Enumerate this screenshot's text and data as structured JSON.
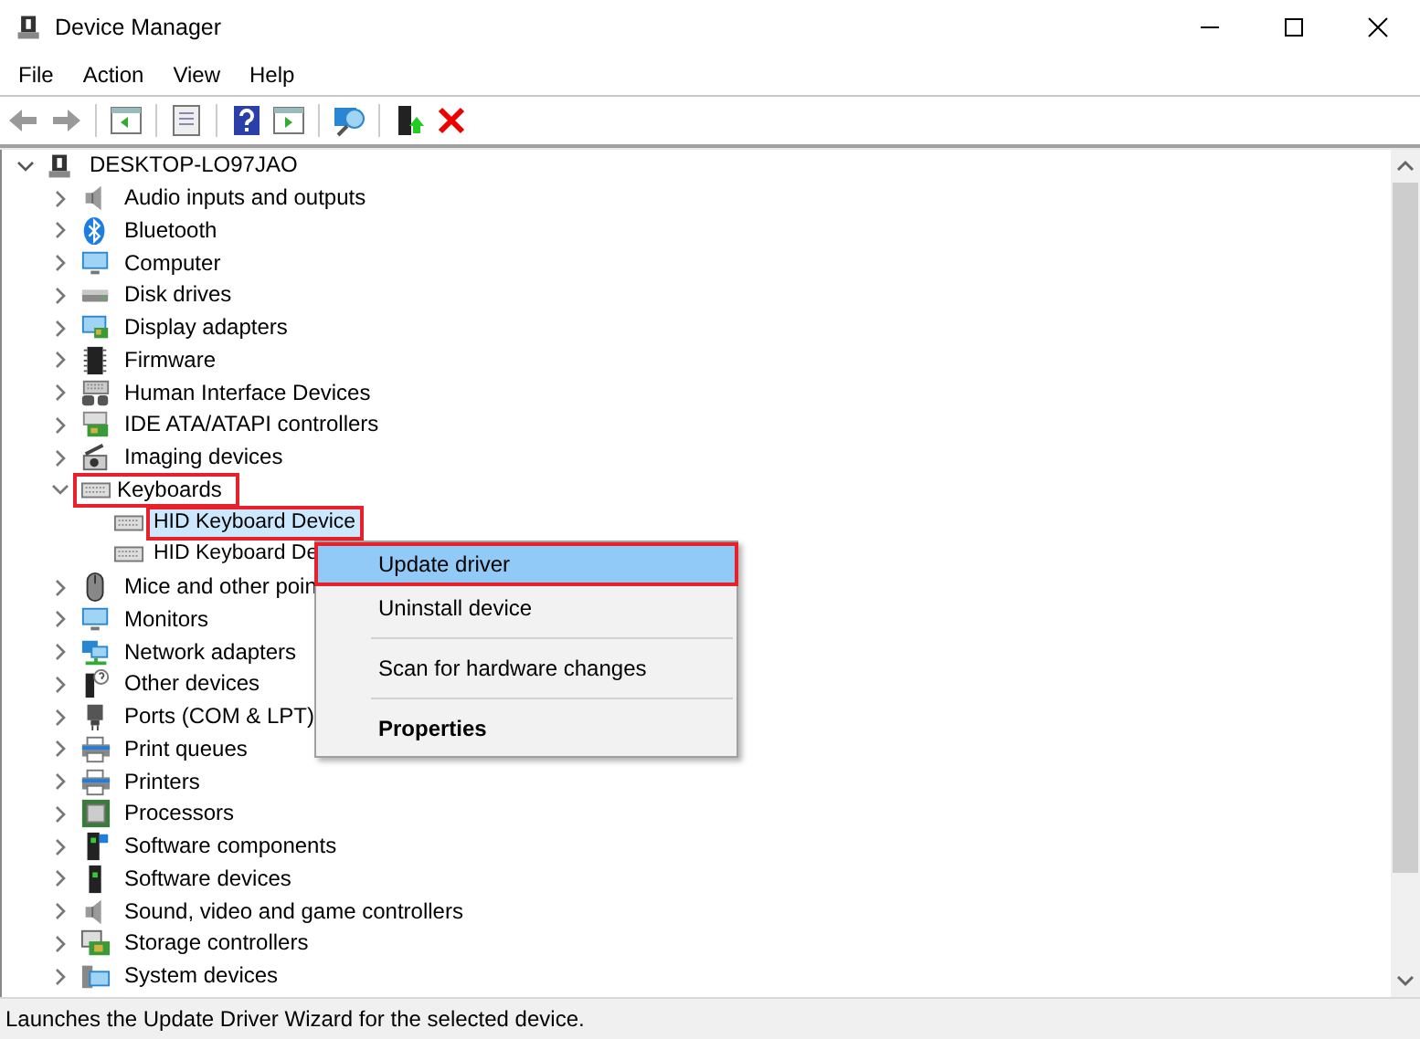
{
  "window": {
    "title": "Device Manager"
  },
  "menu": [
    "File",
    "Action",
    "View",
    "Help"
  ],
  "tree": {
    "label": "DESKTOP-LO97JAO",
    "expanded": true,
    "children": [
      {
        "label": "Audio inputs and outputs",
        "expanded": false,
        "selected": false,
        "highlighted": false
      },
      {
        "label": "Bluetooth",
        "expanded": false,
        "selected": false,
        "highlighted": false
      },
      {
        "label": "Computer",
        "expanded": false,
        "selected": false,
        "highlighted": false
      },
      {
        "label": "Disk drives",
        "expanded": false,
        "selected": false,
        "highlighted": false
      },
      {
        "label": "Display adapters",
        "expanded": false,
        "selected": false,
        "highlighted": false
      },
      {
        "label": "Firmware",
        "expanded": false,
        "selected": false,
        "highlighted": false
      },
      {
        "label": "Human Interface Devices",
        "expanded": false,
        "selected": false,
        "highlighted": false
      },
      {
        "label": "IDE ATA/ATAPI controllers",
        "expanded": false,
        "selected": false,
        "highlighted": false
      },
      {
        "label": "Imaging devices",
        "expanded": false,
        "selected": false,
        "highlighted": false
      },
      {
        "label": "Keyboards",
        "expanded": true,
        "selected": false,
        "highlighted": true,
        "children": [
          {
            "label": "HID Keyboard Device",
            "selected": true,
            "highlighted": true
          },
          {
            "label": "HID Keyboard De",
            "selected": false,
            "highlighted": false
          }
        ]
      },
      {
        "label": "Mice and other poin",
        "expanded": false,
        "selected": false,
        "highlighted": false
      },
      {
        "label": "Monitors",
        "expanded": false,
        "selected": false,
        "highlighted": false
      },
      {
        "label": "Network adapters",
        "expanded": false,
        "selected": false,
        "highlighted": false
      },
      {
        "label": "Other devices",
        "expanded": false,
        "selected": false,
        "highlighted": false
      },
      {
        "label": "Ports (COM & LPT)",
        "expanded": false,
        "selected": false,
        "highlighted": false
      },
      {
        "label": "Print queues",
        "expanded": false,
        "selected": false,
        "highlighted": false
      },
      {
        "label": "Printers",
        "expanded": false,
        "selected": false,
        "highlighted": false
      },
      {
        "label": "Processors",
        "expanded": false,
        "selected": false,
        "highlighted": false
      },
      {
        "label": "Software components",
        "expanded": false,
        "selected": false,
        "highlighted": false
      },
      {
        "label": "Software devices",
        "expanded": false,
        "selected": false,
        "highlighted": false
      },
      {
        "label": "Sound, video and game controllers",
        "expanded": false,
        "selected": false,
        "highlighted": false
      },
      {
        "label": "Storage controllers",
        "expanded": false,
        "selected": false,
        "highlighted": false
      },
      {
        "label": "System devices",
        "expanded": false,
        "selected": false,
        "highlighted": false
      }
    ]
  },
  "context_menu": {
    "items": [
      {
        "kind": "item",
        "label": "Update driver",
        "selected": true,
        "highlighted": true,
        "bold": false
      },
      {
        "kind": "item",
        "label": "Uninstall device",
        "selected": false,
        "highlighted": false,
        "bold": false
      },
      {
        "kind": "separator"
      },
      {
        "kind": "item",
        "label": "Scan for hardware changes",
        "selected": false,
        "highlighted": false,
        "bold": false
      },
      {
        "kind": "separator"
      },
      {
        "kind": "item",
        "label": "Properties",
        "selected": false,
        "highlighted": false,
        "bold": true
      }
    ]
  },
  "status_bar": "Launches the Update Driver Wizard for the selected device."
}
